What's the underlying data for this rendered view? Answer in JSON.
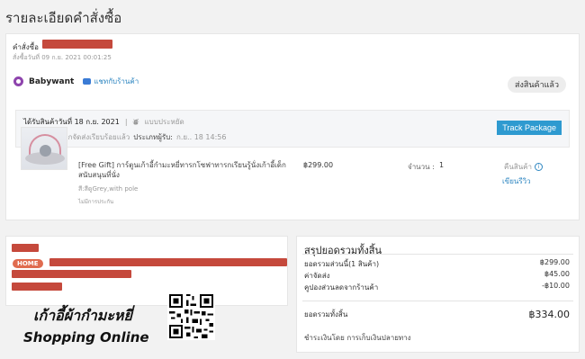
{
  "page": {
    "title": "รายละเอียดคำสั่งซื้อ"
  },
  "order": {
    "number_label": "คำสั่งซื้อ",
    "ordered_at": "สั่งซื้อวันที่ 09 ก.ย. 2021 00:01:25"
  },
  "shop": {
    "name": "Babywant",
    "chat_label": "แชทกับร้านค้า",
    "status": "ส่งสินค้าแล้ว"
  },
  "delivery": {
    "received_date": "ได้รับสินค้าวันที่ 18 ก.ย. 2021",
    "separator": "|",
    "shipping_type": "แบบประหยัด",
    "message": "พัสดุของท่านถูกจัดส่งเรียบร้อยแล้ว",
    "tracking_label": "ประเภทผู้รับ:",
    "tracking_value": "ก.ย.. 18 14:56",
    "track_button": "Track Package"
  },
  "product": {
    "title": "[Free Gift] การ์ตูนเก้าอี้กำมะหยี่ทารกโซฟาทารกเรียนรู้นั่งเก้าอี้เด็กสนับสนุนที่นั่ง",
    "variant": "สี:สีดูGrey,with pole",
    "warranty": "ไม่มีการประกัน",
    "price": "฿299.00",
    "qty_label": "จำนวน :",
    "qty_value": "1",
    "return_label": "คืนสินค้า",
    "review_label": "เขียนรีวิว"
  },
  "address": {
    "tag": "HOME"
  },
  "summary": {
    "title": "สรุปยอดรวมทั้งสิ้น",
    "rows": [
      {
        "label": "ยอดรวมส่วนนี้(1 สินค้า)",
        "value": "฿299.00"
      },
      {
        "label": "ค่าจัดส่ง",
        "value": "฿45.00"
      },
      {
        "label": "คูปองส่วนลดจากร้านค้า",
        "value": "-฿10.00"
      }
    ],
    "total_label": "ยอดรวมทั้งสิ้น",
    "total_value": "฿334.00",
    "payment": "ชำระเงินโดย การเก็บเงินปลายทาง"
  },
  "promo": {
    "line1": "เก้าอี้ผ้ากำมะหยี่",
    "line2": "Shopping Online"
  },
  "colors": {
    "accent": "#2e9ad0",
    "redaction": "#c0392b",
    "home_tag": "#e06b4f"
  }
}
